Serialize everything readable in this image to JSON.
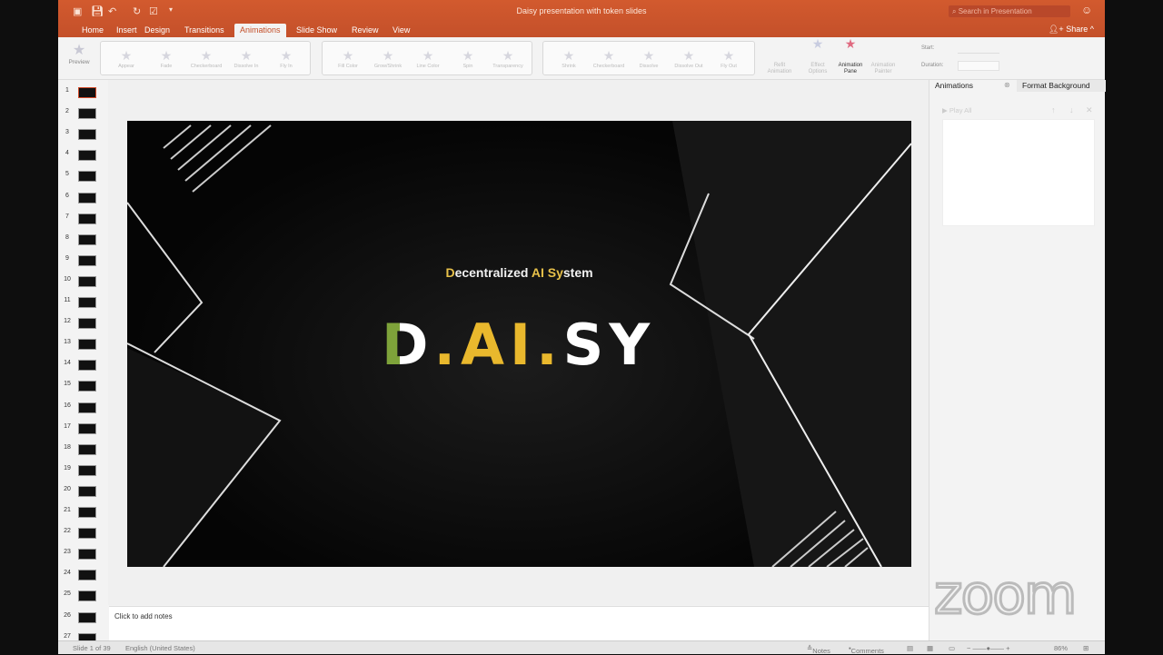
{
  "window": {
    "title": "Daisy presentation with token slides",
    "search_placeholder": "Search in Presentation",
    "share": "Share"
  },
  "tabs": [
    "Home",
    "Insert",
    "Design",
    "Transitions",
    "Animations",
    "Slide Show",
    "Review",
    "View"
  ],
  "active_tab": "Animations",
  "ribbon": {
    "preview": "Preview",
    "entrance": [
      "Appear",
      "Fade",
      "Checkerboard",
      "Dissolve In",
      "Fly In"
    ],
    "emphasis": [
      "Fill Color",
      "Grow/Shrink",
      "Line Color",
      "Spin",
      "Transparency"
    ],
    "exit": [
      "Shrink",
      "Checkerboard",
      "Dissolve",
      "Dissolve Out",
      "Fly Out"
    ],
    "reorder": "Refit Animation",
    "effect_options": "Effect Options",
    "animation_pane": "Animation Pane",
    "animation_painter": "Animation Painter",
    "start_label": "Start:",
    "duration_label": "Duration:"
  },
  "slides": [
    "1",
    "2",
    "3",
    "4",
    "5",
    "6",
    "7",
    "8",
    "9",
    "10",
    "11",
    "12",
    "13",
    "14",
    "15",
    "16",
    "17",
    "18",
    "19",
    "20",
    "21",
    "22",
    "23",
    "24",
    "25",
    "26",
    "27"
  ],
  "selected_slide": 1,
  "slide": {
    "tagline_parts": [
      "D",
      "ecentralized ",
      "AI",
      " ",
      "Sy",
      "stem"
    ],
    "logo_parts": [
      "D",
      ".AI.",
      "SY"
    ]
  },
  "notes_placeholder": "Click to add notes",
  "pane": {
    "tab_animations": "Animations",
    "tab_format": "Format Background",
    "play_all": "▶ Play All"
  },
  "status": {
    "slide": "Slide 1 of 39",
    "language": "English (United States)",
    "notes": "Notes",
    "comments": "Comments",
    "zoom": "86%"
  },
  "watermark": "zoom",
  "colors": {
    "accent": "#c4502a",
    "logo_gold": "#e9b82d",
    "logo_green": "#7ea33a"
  }
}
